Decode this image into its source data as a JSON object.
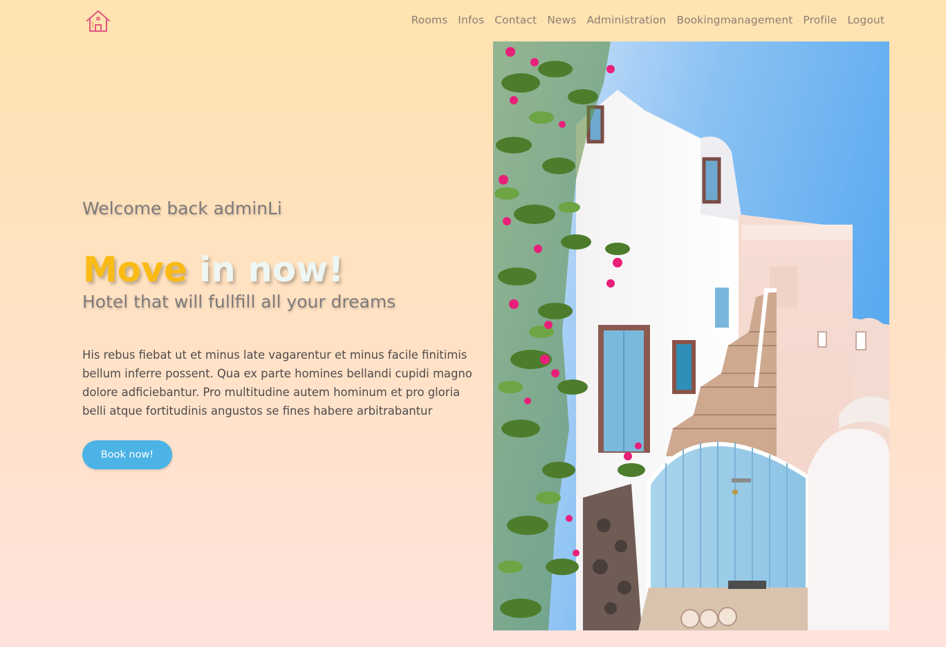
{
  "header": {
    "logo_icon": "house-icon",
    "nav": [
      {
        "label": "Rooms"
      },
      {
        "label": "Infos"
      },
      {
        "label": "Contact"
      },
      {
        "label": "News"
      },
      {
        "label": "Administration"
      },
      {
        "label": "Bookingmanagement"
      },
      {
        "label": "Profile"
      },
      {
        "label": "Logout"
      }
    ]
  },
  "hero": {
    "welcome": "Welcome back adminLi",
    "title_accent": "Move",
    "title_rest": " in now!",
    "subtitle": "Hotel that will fullfill all your dreams",
    "body": "His rebus fiebat ut et minus late vagarentur et minus facile finitimis bellum inferre possent. Qua ex parte homines bellandi cupidi magno dolore adficiebantur. Pro multitudine autem hominum et pro gloria belli atque fortitudinis angustos se fines habere arbitrabantur",
    "cta_label": "Book now!"
  },
  "colors": {
    "accent_yellow": "#fbbb16",
    "button_blue": "#4bb3e5",
    "logo_pink": "#e0577f"
  }
}
